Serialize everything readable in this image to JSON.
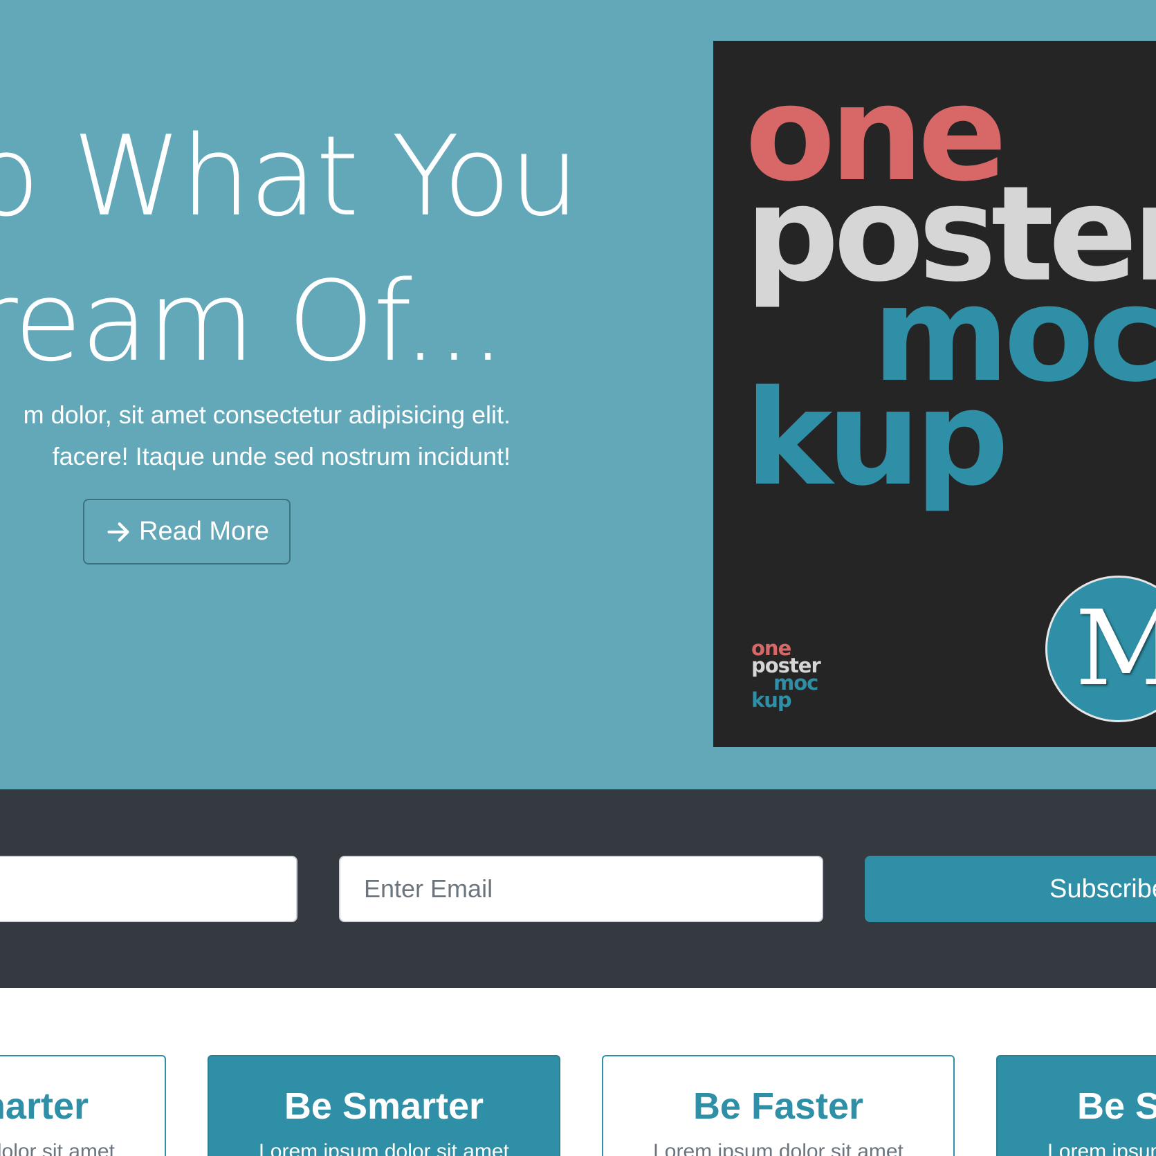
{
  "hero": {
    "title_line_1": "o What You",
    "title_line_2": "ream Of...",
    "subtitle_line_1": "m dolor, sit amet consectetur adipisicing elit.",
    "subtitle_line_2": "facere! Itaque unde sed nostrum incidunt!",
    "read_more_label": "Read More",
    "read_more_icon": "arrow-right-icon"
  },
  "poster": {
    "word_1": "one",
    "word_2": "poster",
    "word_3": "moc",
    "word_4": "kup",
    "mini_logo": [
      "one",
      "poster",
      "moc",
      "kup"
    ],
    "badge_letter": "M"
  },
  "subscribe": {
    "email_placeholder": "Enter Email",
    "button_label": "Subscribe"
  },
  "cards": [
    {
      "title": "Be Smarter",
      "text": "Lorem ipsum dolor sit amet"
    },
    {
      "title": "Be Smarter",
      "text": "Lorem ipsum dolor sit amet"
    },
    {
      "title": "Be Faster",
      "text": "Lorem ipsum dolor sit amet"
    },
    {
      "title": "Be Smarter",
      "text": "Lorem ipsum dolor sit amet"
    }
  ],
  "colors": {
    "hero_bg": "#62a8b8",
    "band_bg": "#343a40",
    "accent": "#2e8fa6",
    "poster_bg": "#252525",
    "poster_red": "#d86868",
    "poster_gray": "#d6d6d6"
  }
}
